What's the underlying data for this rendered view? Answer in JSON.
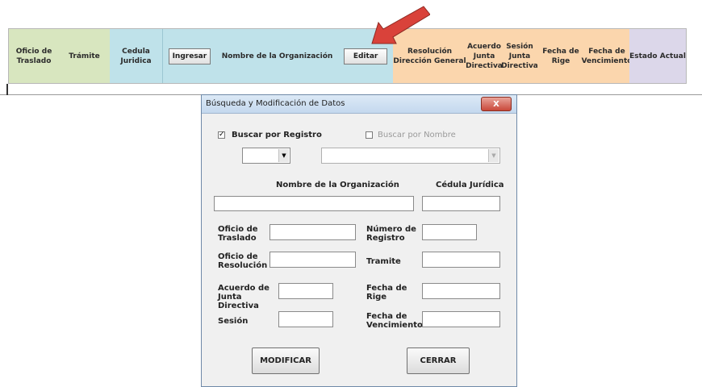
{
  "header": {
    "oficio_traslado": "Oficio de Traslado",
    "tramite": "Trámite",
    "cedula_juridica": "Cedula Juridica",
    "ingresar_button": "Ingresar",
    "nombre_organizacion": "Nombre de la Organización",
    "editar_button": "Editar",
    "resolucion": "Resolución Dirección General",
    "acuerdo": "Acuerdo Junta Directiva",
    "sesion": "Sesión Junta Directiva",
    "fecha_rige": "Fecha de Rige",
    "fecha_vencimiento": "Fecha de Vencimiento",
    "estado_actual": "Estado Actual"
  },
  "dialog": {
    "title": "Búsqueda y Modificación de Datos",
    "close_label": "X",
    "buscar_registro": "Buscar por Registro",
    "buscar_nombre": "Buscar por Nombre",
    "nombre_org_label": "Nombre de la Organización",
    "cedula_label": "Cédula Jurídica",
    "oficio_traslado_label": "Oficio de Traslado",
    "numero_registro_label": "Número de Registro",
    "oficio_resolucion_label": "Oficio de Resolución",
    "tramite_label": "Tramite",
    "acuerdo_label": "Acuerdo de Junta Directiva",
    "fecha_rige_label": "Fecha de Rige",
    "sesion_label": "Sesión",
    "fecha_vencimiento_label": "Fecha de Vencimiento",
    "modificar_button": "MODIFICAR",
    "cerrar_button": "CERRAR"
  },
  "colors": {
    "arrow": "#d9423a",
    "green": "#d8e6bf",
    "blue": "#bfe2ea",
    "orange": "#fbd6ad",
    "purple": "#dcd7ea"
  }
}
